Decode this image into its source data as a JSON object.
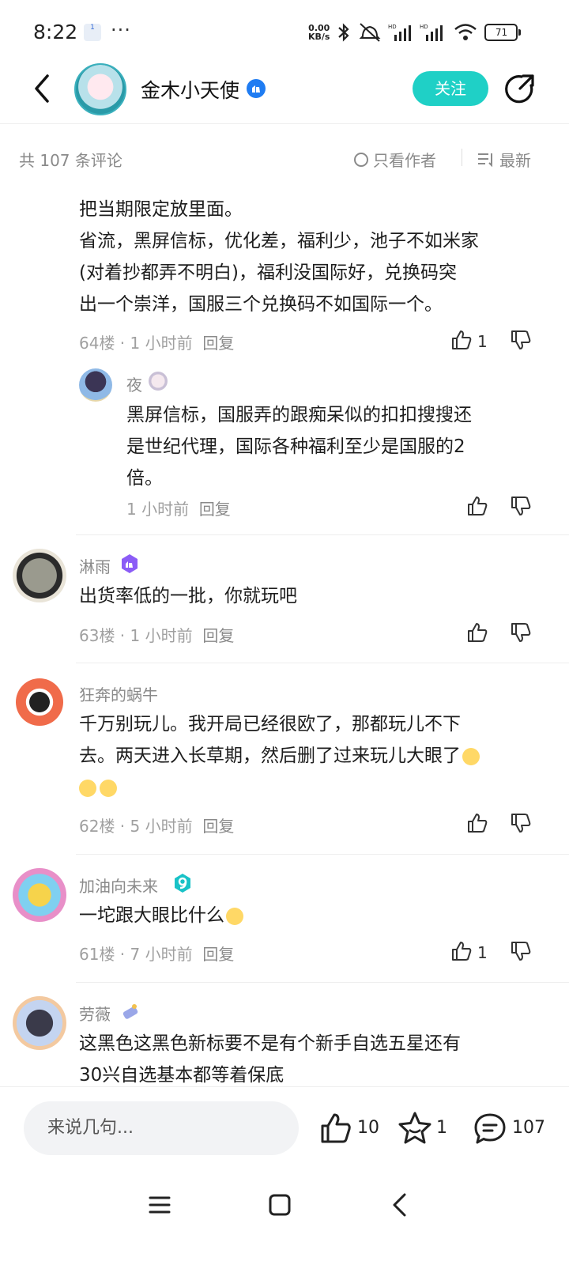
{
  "status": {
    "time": "8:22",
    "notif_badge": "1",
    "dots": "···",
    "net_speed_top": "0.00",
    "net_speed_unit": "KB/s",
    "battery": "71"
  },
  "header": {
    "title": "金木小天使",
    "follow_label": "关注"
  },
  "filter": {
    "count_label": "共 107 条评论",
    "author_only": "只看作者",
    "sort": "最新"
  },
  "comments": [
    {
      "text_lines": [
        "把当期限定放里面。",
        "省流，黑屏信标，优化差，福利少，池子不如米家",
        "(对着抄都弄不明白)，福利没国际好，兑换码突",
        "出一个崇洋，国服三个兑换码不如国际一个。"
      ],
      "meta": "64楼 · 1 小时前",
      "reply": "回复",
      "likes": "1"
    },
    {
      "user": "夜",
      "text_lines": [
        "黑屏信标，国服弄的跟痴呆似的扣扣搜搜还",
        "是世纪代理，国际各种福利至少是国服的2",
        "倍。"
      ],
      "meta": "1 小时前",
      "reply": "回复"
    },
    {
      "user": "淋雨",
      "text_lines": [
        "出货率低的一批，你就玩吧"
      ],
      "meta": "63楼 · 1 小时前",
      "reply": "回复"
    },
    {
      "user": "狂奔的蜗牛",
      "text_lines": [
        "千万别玩儿。我开局已经很欧了，那都玩儿不下",
        "去。两天进入长草期，然后删了过来玩儿大眼了"
      ],
      "meta": "62楼 · 5 小时前",
      "reply": "回复"
    },
    {
      "user": "加油向未来",
      "text_lines": [
        "一坨跟大眼比什么"
      ],
      "meta": "61楼 · 7 小时前",
      "reply": "回复",
      "likes": "1"
    },
    {
      "user": "劳薇",
      "text_lines": [
        "这黑色这黑色新标要不是有个新手自选五星还有",
        "30兴自选基本都等着保底"
      ]
    }
  ],
  "bottom": {
    "input_placeholder": "来说几句...",
    "likes": "10",
    "stars": "1",
    "comments": "107"
  },
  "colors": {
    "accent": "#1fd0c6",
    "verified": "#1f7cf2",
    "level_purple": "#8b5cf6",
    "level_teal": "#19c2c7"
  }
}
